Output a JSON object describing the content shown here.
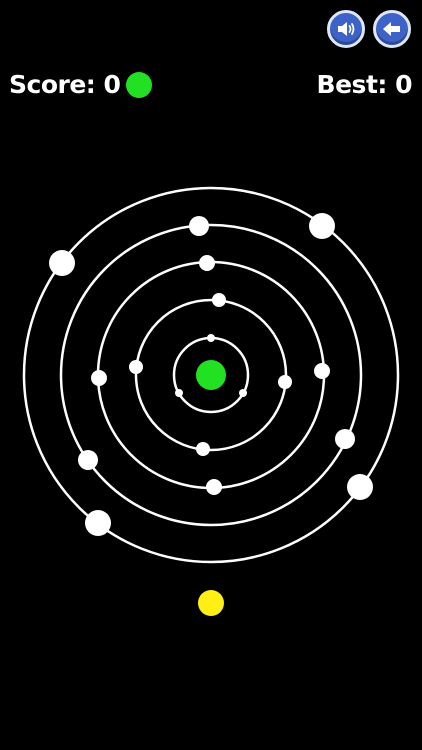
{
  "hud": {
    "score_label": "Score: 0",
    "best_label": "Best: 0",
    "player_color": "#22e022"
  },
  "controls": {
    "sound_icon": "speaker-icon",
    "back_icon": "back-arrow-icon"
  },
  "colors": {
    "background": "#000000",
    "ring": "#ffffff",
    "orbiter": "#ffffff",
    "core": "#22e022",
    "next_ball": "#ffef14",
    "button_fill": "#3d63c9",
    "button_border": "#dfe6f7"
  },
  "game": {
    "rings": 5,
    "next_ball_color": "#ffef14"
  }
}
